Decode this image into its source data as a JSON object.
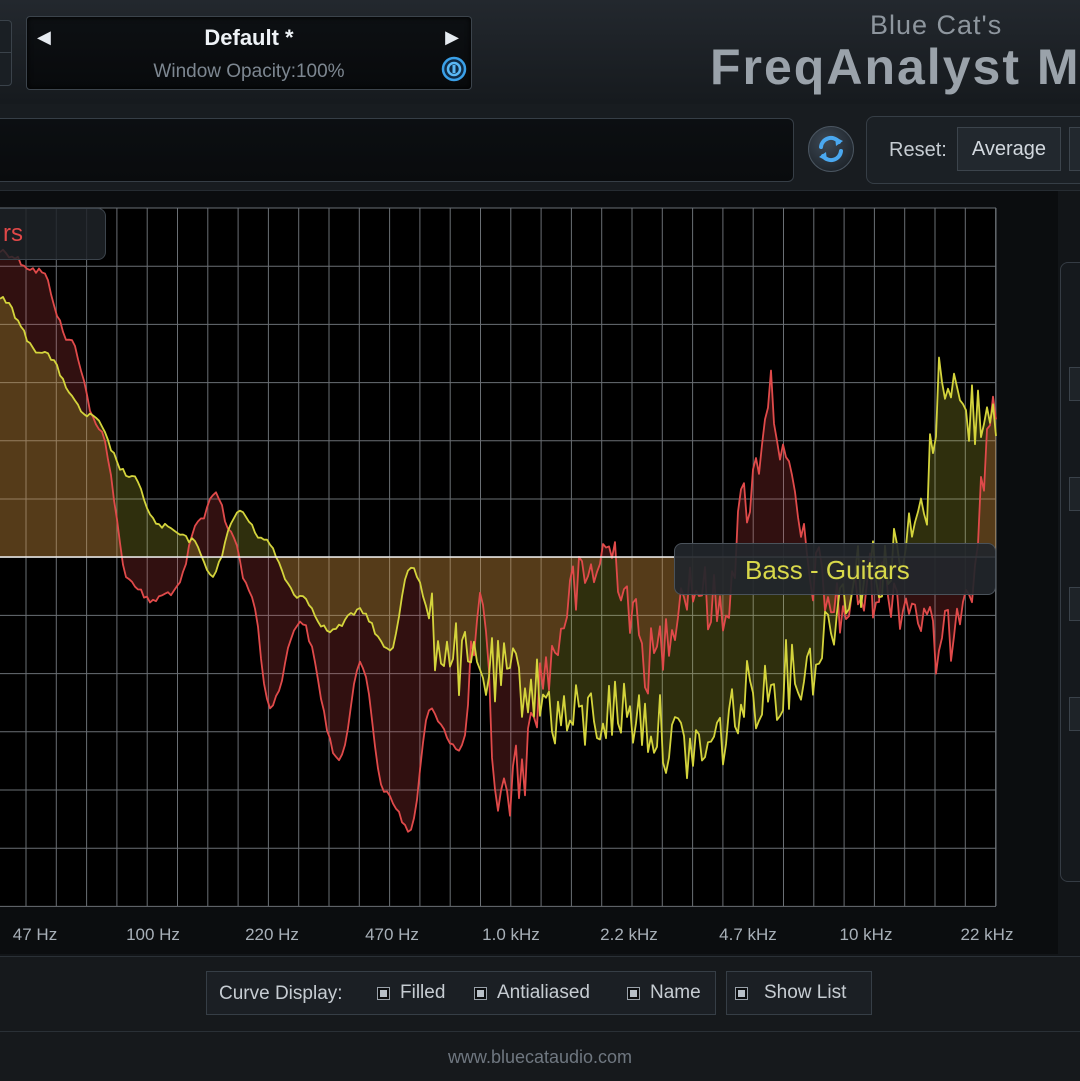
{
  "preset": {
    "name": "Default *",
    "window_opacity": "Window Opacity:100%",
    "prev_icon": "left-triangle-icon",
    "next_icon": "right-triangle-icon"
  },
  "brand": {
    "vendor": "Blue Cat's",
    "product": "FreqAnalyst M"
  },
  "toolbar": {
    "reset_label": "Reset:",
    "average_label": "Average"
  },
  "graph": {
    "curve_name_cut": "rs",
    "tooltip": "Bass - Guitars",
    "freq_labels": [
      "47 Hz",
      "100 Hz",
      "220 Hz",
      "470 Hz",
      "1.0 kHz",
      "2.2 kHz",
      "4.7 kHz",
      "10 kHz",
      "22 kHz"
    ],
    "colors": {
      "red_curve": "#e04a4a",
      "yellow_curve": "#d4d43c",
      "grid": "#6a6f74",
      "zero_line": "#f0f0f0"
    }
  },
  "bottom": {
    "curve_display_label": "Curve Display:",
    "filled_label": "Filled",
    "antialiased_label": "Antialiased",
    "name_label": "Name",
    "show_list_label": "Show List",
    "website": "www.bluecataudio.com"
  }
}
